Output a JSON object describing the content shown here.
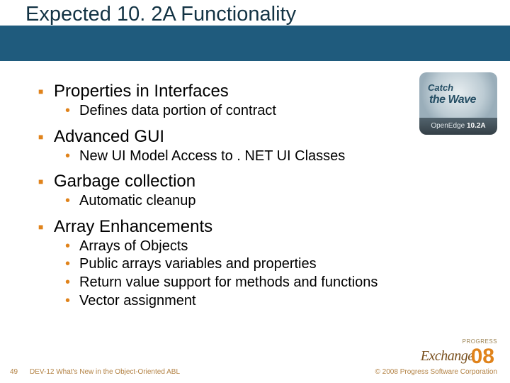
{
  "title": "Expected 10. 2A Functionality",
  "badge": {
    "line1": "Catch",
    "line2": "the Wave",
    "product": "OpenEdge",
    "version": "10.2A"
  },
  "sections": [
    {
      "heading": "Properties in Interfaces",
      "bullets": [
        "Defines data portion of contract"
      ]
    },
    {
      "heading": "Advanced GUI",
      "bullets": [
        "New UI Model Access to . NET UI Classes"
      ]
    },
    {
      "heading": "Garbage collection",
      "bullets": [
        "Automatic cleanup"
      ]
    },
    {
      "heading": "Array Enhancements",
      "bullets": [
        "Arrays of Objects",
        "Public arrays variables and properties",
        "Return value support for methods and functions",
        "Vector assignment"
      ]
    }
  ],
  "footer": {
    "page": "49",
    "left": "DEV-12 What's New in the Object-Oriented ABL",
    "right": "© 2008 Progress Software Corporation"
  },
  "logo": {
    "brand": "PROGRESS",
    "event": "Exchange",
    "year": "08"
  }
}
